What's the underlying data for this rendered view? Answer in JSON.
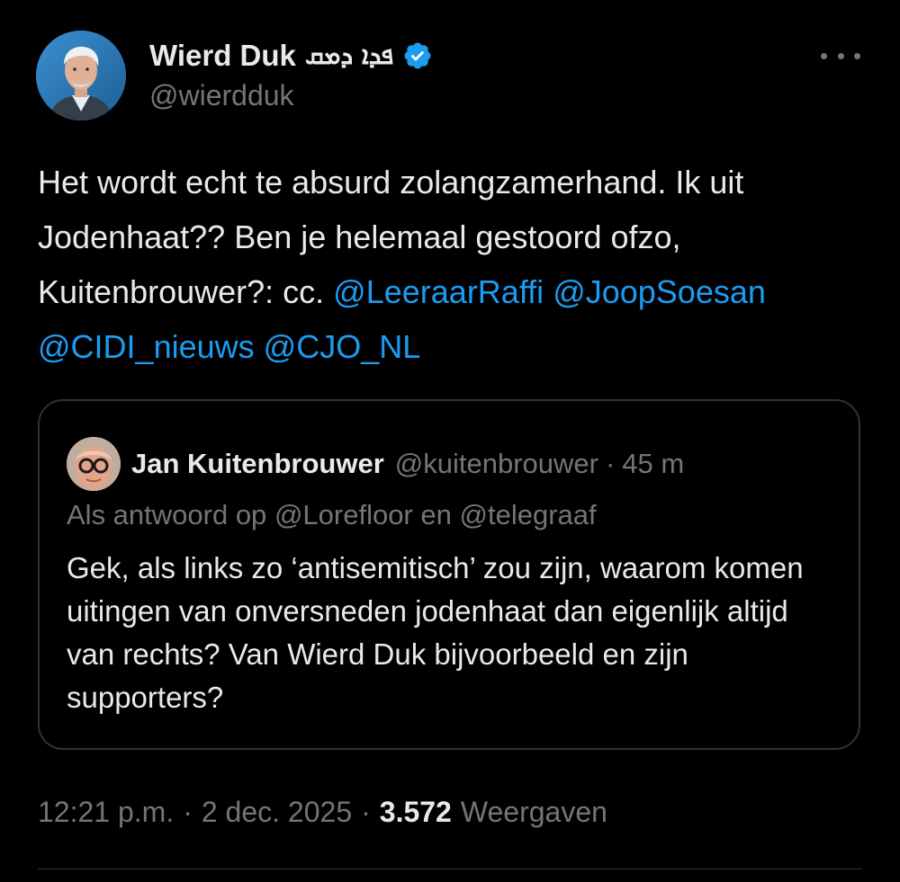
{
  "tweet": {
    "author_name": "Wierd Duk",
    "author_name_suffix": "ܦܕܐ ܕܡܩ",
    "author_handle": "@wierdduk",
    "verified_color": "#1d9bf0",
    "more_icon": "more-horizontal-icon",
    "text_segments": [
      {
        "text": "Het wordt echt te absurd zolangzamerhand. Ik uit Jodenhaat?? Ben je helemaal gestoord ofzo, Kuitenbrouwer?: cc. ",
        "mention": false
      },
      {
        "text": "@LeeraarRaffi",
        "mention": true
      },
      {
        "text": " ",
        "mention": false
      },
      {
        "text": "@JoopSoesan",
        "mention": true
      },
      {
        "text": " ",
        "mention": false
      },
      {
        "text": "@CIDI_nieuws",
        "mention": true
      },
      {
        "text": " ",
        "mention": false
      },
      {
        "text": "@CJO_NL",
        "mention": true
      }
    ],
    "mention_color": "#1d9bf0"
  },
  "quote": {
    "author_name": "Jan Kuitenbrouwer",
    "author_handle": "@kuitenbrouwer",
    "separator": "·",
    "time": "45 m",
    "reply_prefix": "Als antwoord op",
    "reply_mention_1": "@Lorefloor",
    "reply_joiner": "en",
    "reply_mention_2": "@telegraaf",
    "text": "Gek, als links zo ‘antisemitisch’ zou zijn, waarom komen uitingen van onversneden jodenhaat dan eigenlijk altijd van rechts? Van Wierd Duk bijvoorbeeld en zijn supporters?"
  },
  "meta": {
    "time": "12:21 p.m.",
    "separator": "·",
    "date": "2 dec. 2025",
    "views_count": "3.572",
    "views_label": "Weergaven"
  },
  "colors": {
    "background": "#000000",
    "text_primary": "#e7e9ea",
    "text_secondary": "#71767b",
    "border": "#2f3336",
    "accent": "#1d9bf0"
  }
}
